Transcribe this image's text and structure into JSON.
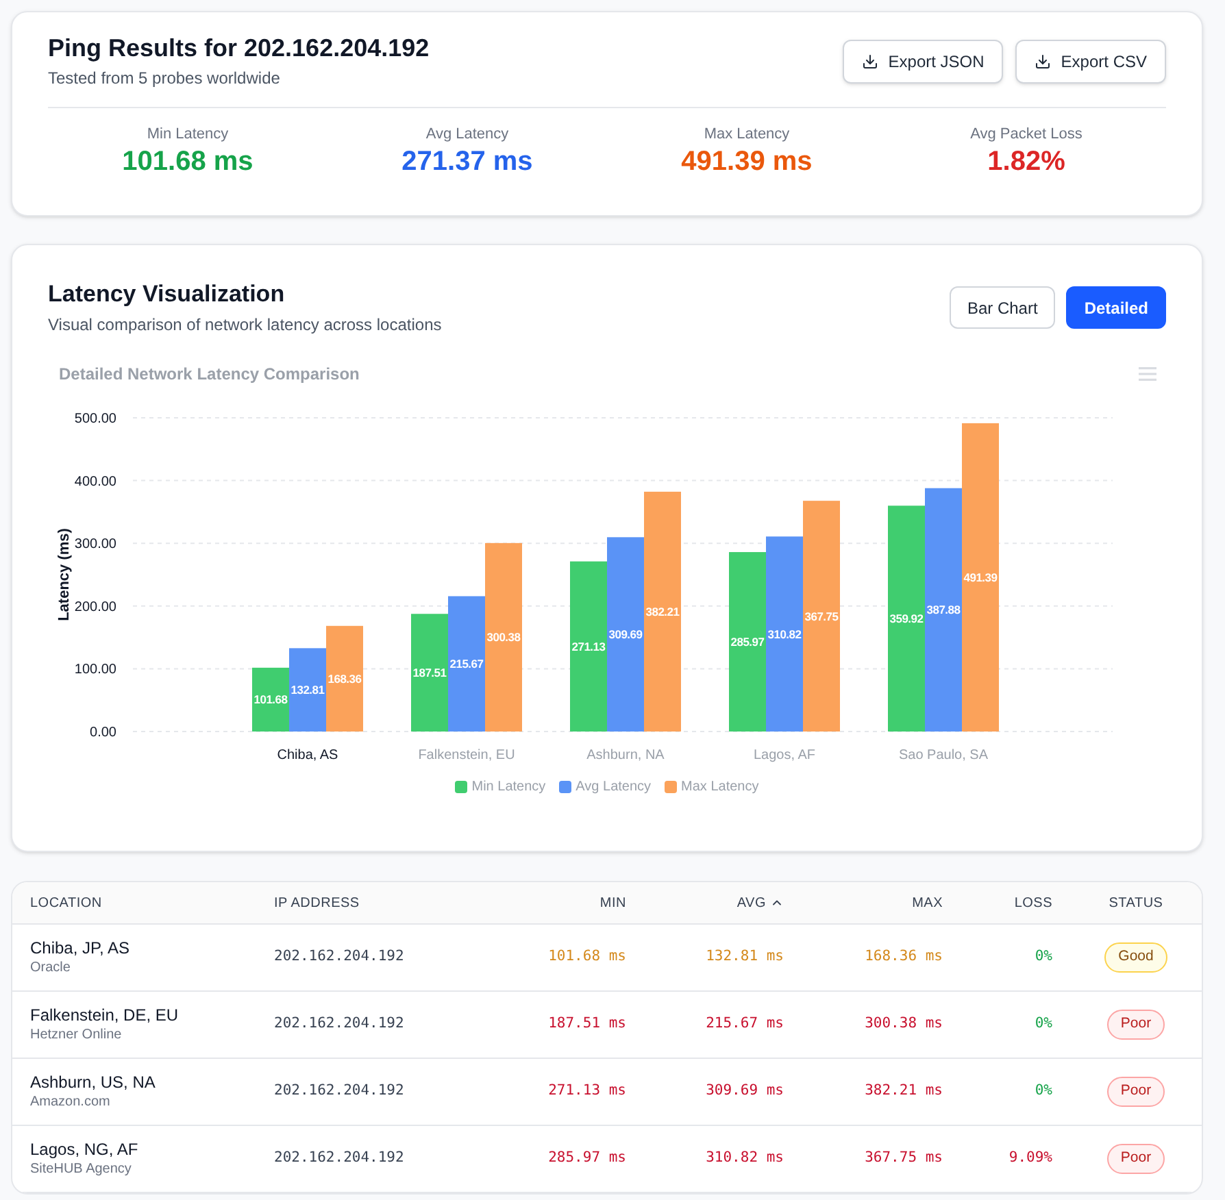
{
  "results": {
    "title": "Ping Results for 202.162.204.192",
    "subtitle": "Tested from 5 probes worldwide",
    "buttons": [
      {
        "label": "Export JSON"
      },
      {
        "label": "Export CSV"
      }
    ],
    "stats": [
      {
        "label": "Min Latency",
        "value": "101.68 ms",
        "color": "#16a34a"
      },
      {
        "label": "Avg Latency",
        "value": "271.37 ms",
        "color": "#2563eb"
      },
      {
        "label": "Max Latency",
        "value": "491.39 ms",
        "color": "#ea580c"
      },
      {
        "label": "Avg Packet Loss",
        "value": "1.82%",
        "color": "#dc2626"
      }
    ]
  },
  "visualization": {
    "title": "Latency Visualization",
    "subtitle": "Visual comparison of network latency across locations",
    "view_buttons": [
      {
        "label": "Bar Chart",
        "selected": false
      },
      {
        "label": "Detailed",
        "selected": true
      }
    ],
    "category_selected": [
      true,
      false,
      false,
      false,
      false
    ],
    "chart_data": {
      "type": "bar",
      "title": "Detailed Network Latency Comparison",
      "ylabel": "Latency (ms)",
      "categories": [
        "Chiba, AS",
        "Falkenstein, EU",
        "Ashburn, NA",
        "Lagos, AF",
        "Sao Paulo, SA"
      ],
      "series": [
        {
          "name": "Min Latency",
          "color": "#40cd6f",
          "values": [
            101.68,
            187.51,
            271.13,
            285.97,
            359.92
          ]
        },
        {
          "name": "Avg Latency",
          "color": "#5a93f6",
          "values": [
            132.81,
            215.67,
            309.69,
            310.82,
            387.88
          ]
        },
        {
          "name": "Max Latency",
          "color": "#fba25a",
          "values": [
            168.36,
            300.38,
            382.21,
            367.75,
            491.39
          ]
        }
      ],
      "ylim": [
        0,
        500
      ],
      "yticks": [
        {
          "value": 0,
          "label": "0.00"
        },
        {
          "value": 100,
          "label": "100.00"
        },
        {
          "value": 200,
          "label": "200.00"
        },
        {
          "value": 300,
          "label": "300.00"
        },
        {
          "value": 400,
          "label": "400.00"
        },
        {
          "value": 500,
          "label": "500.00"
        }
      ],
      "grid": true,
      "legend": "bottom",
      "data_labels": true
    }
  },
  "table": {
    "columns": [
      {
        "label": "LOCATION",
        "sorted": false
      },
      {
        "label": "IP ADDRESS",
        "sorted": false
      },
      {
        "label": "MIN",
        "sorted": false
      },
      {
        "label": "AVG",
        "sorted": true
      },
      {
        "label": "MAX",
        "sorted": false
      },
      {
        "label": "LOSS",
        "sorted": false
      },
      {
        "label": "STATUS",
        "sorted": false
      }
    ],
    "rows": [
      {
        "location": "Chiba, JP, AS",
        "provider": "Oracle",
        "ip": "202.162.204.192",
        "min": "101.68 ms",
        "avg": "132.81 ms",
        "max": "168.36 ms",
        "loss": {
          "text": "0%",
          "kind": "ok"
        },
        "status": "Good",
        "kind": "good"
      },
      {
        "location": "Falkenstein, DE, EU",
        "provider": "Hetzner Online",
        "ip": "202.162.204.192",
        "min": "187.51 ms",
        "avg": "215.67 ms",
        "max": "300.38 ms",
        "loss": {
          "text": "0%",
          "kind": "ok"
        },
        "status": "Poor",
        "kind": "poor"
      },
      {
        "location": "Ashburn, US, NA",
        "provider": "Amazon.com",
        "ip": "202.162.204.192",
        "min": "271.13 ms",
        "avg": "309.69 ms",
        "max": "382.21 ms",
        "loss": {
          "text": "0%",
          "kind": "ok"
        },
        "status": "Poor",
        "kind": "poor"
      },
      {
        "location": "Lagos, NG, AF",
        "provider": "SiteHUB Agency",
        "ip": "202.162.204.192",
        "min": "285.97 ms",
        "avg": "310.82 ms",
        "max": "367.75 ms",
        "loss": {
          "text": "9.09%",
          "kind": "high"
        },
        "status": "Poor",
        "kind": "poor"
      }
    ]
  }
}
